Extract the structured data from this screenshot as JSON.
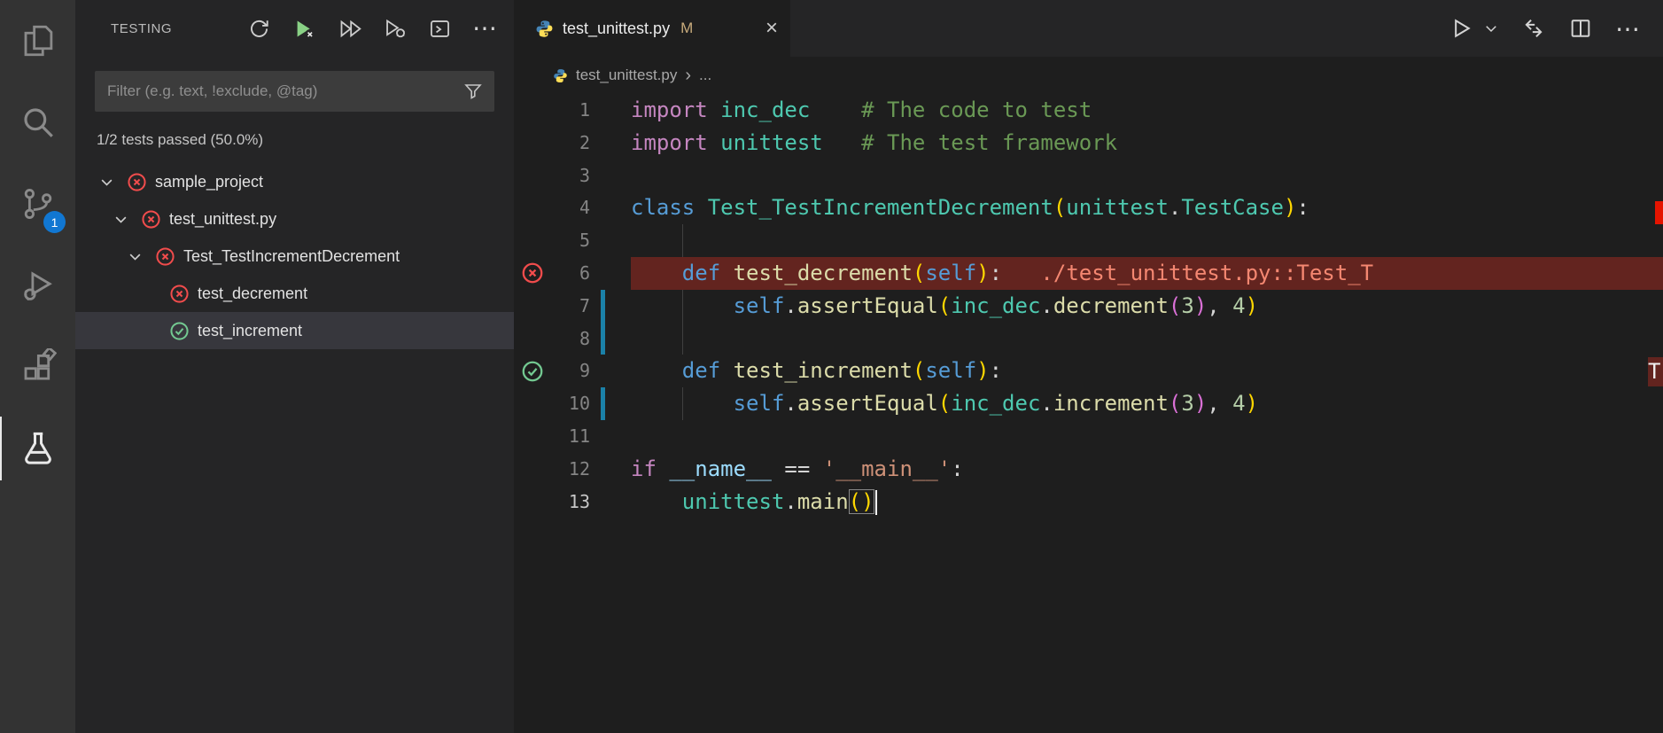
{
  "colors": {
    "accent_blue": "#1177d2",
    "error_red": "#f14c4c",
    "pass_green": "#73c991",
    "modified_gold": "#c8ab7c",
    "error_line_bg": "#63241f",
    "modified_line_blue": "#1b81a8"
  },
  "activity_bar": {
    "source_control_badge": "1"
  },
  "sidebar": {
    "title": "TESTING",
    "filter": {
      "placeholder": "Filter (e.g. text, !exclude, @tag)"
    },
    "status": "1/2 tests passed (50.0%)",
    "tree": [
      {
        "label": "sample_project",
        "state": "fail",
        "expanded": true,
        "indent": 0
      },
      {
        "label": "test_unittest.py",
        "state": "fail",
        "expanded": true,
        "indent": 1
      },
      {
        "label": "Test_TestIncrementDecrement",
        "state": "fail",
        "expanded": true,
        "indent": 2
      },
      {
        "label": "test_decrement",
        "state": "fail",
        "indent": 3,
        "leaf": true
      },
      {
        "label": "test_increment",
        "state": "pass",
        "indent": 3,
        "leaf": true,
        "selected": true
      }
    ]
  },
  "editor": {
    "tab": {
      "label": "test_unittest.py",
      "modified": "M"
    },
    "breadcrumb": {
      "file": "test_unittest.py",
      "more": "..."
    },
    "overlays": {
      "clipped_text": "T"
    },
    "code": {
      "lines": [
        {
          "n": 1,
          "tokens": [
            [
              "kw",
              "import"
            ],
            [
              "pl",
              " "
            ],
            [
              "typ",
              "inc_dec"
            ],
            [
              "pl",
              "    "
            ],
            [
              "cm",
              "# The code to test"
            ]
          ]
        },
        {
          "n": 2,
          "tokens": [
            [
              "kw",
              "import"
            ],
            [
              "pl",
              " "
            ],
            [
              "typ",
              "unittest"
            ],
            [
              "pl",
              "   "
            ],
            [
              "cm",
              "# The test framework"
            ]
          ]
        },
        {
          "n": 3,
          "tokens": []
        },
        {
          "n": 4,
          "tokens": [
            [
              "def",
              "class"
            ],
            [
              "pl",
              " "
            ],
            [
              "typ",
              "Test_TestIncrementDecrement"
            ],
            [
              "b1",
              "("
            ],
            [
              "typ",
              "unittest"
            ],
            [
              "pl",
              "."
            ],
            [
              "typ",
              "TestCase"
            ],
            [
              "b1",
              ")"
            ],
            [
              "pl",
              ":"
            ]
          ]
        },
        {
          "n": 5,
          "guides": [
            4
          ],
          "tokens": []
        },
        {
          "n": 6,
          "error": true,
          "test": "fail",
          "tokens": [
            [
              "pl",
              "    "
            ],
            [
              "def",
              "def"
            ],
            [
              "pl",
              " "
            ],
            [
              "fn",
              "test_decrement"
            ],
            [
              "b1",
              "("
            ],
            [
              "def",
              "self"
            ],
            [
              "b1",
              ")"
            ],
            [
              "pl",
              ":"
            ],
            [
              "pl",
              "   "
            ],
            [
              "err",
              "./test_unittest.py::Test_T"
            ]
          ]
        },
        {
          "n": 7,
          "mod": true,
          "guides": [
            4
          ],
          "tokens": [
            [
              "pl",
              "        "
            ],
            [
              "def",
              "self"
            ],
            [
              "pl",
              "."
            ],
            [
              "fn",
              "assertEqual"
            ],
            [
              "b1",
              "("
            ],
            [
              "typ",
              "inc_dec"
            ],
            [
              "pl",
              "."
            ],
            [
              "fn",
              "decrement"
            ],
            [
              "b2",
              "("
            ],
            [
              "num",
              "3"
            ],
            [
              "b2",
              ")"
            ],
            [
              "pl",
              ", "
            ],
            [
              "num",
              "4"
            ],
            [
              "b1",
              ")"
            ]
          ]
        },
        {
          "n": 8,
          "mod": true,
          "guides": [
            4
          ],
          "tokens": []
        },
        {
          "n": 9,
          "test": "pass",
          "tokens": [
            [
              "pl",
              "    "
            ],
            [
              "def",
              "def"
            ],
            [
              "pl",
              " "
            ],
            [
              "fn",
              "test_increment"
            ],
            [
              "b1",
              "("
            ],
            [
              "def",
              "self"
            ],
            [
              "b1",
              ")"
            ],
            [
              "pl",
              ":"
            ]
          ]
        },
        {
          "n": 10,
          "mod": true,
          "guides": [
            4
          ],
          "tokens": [
            [
              "pl",
              "        "
            ],
            [
              "def",
              "self"
            ],
            [
              "pl",
              "."
            ],
            [
              "fn",
              "assertEqual"
            ],
            [
              "b1",
              "("
            ],
            [
              "typ",
              "inc_dec"
            ],
            [
              "pl",
              "."
            ],
            [
              "fn",
              "increment"
            ],
            [
              "b2",
              "("
            ],
            [
              "num",
              "3"
            ],
            [
              "b2",
              ")"
            ],
            [
              "pl",
              ", "
            ],
            [
              "num",
              "4"
            ],
            [
              "b1",
              ")"
            ]
          ]
        },
        {
          "n": 11,
          "tokens": []
        },
        {
          "n": 12,
          "tokens": [
            [
              "kw",
              "if"
            ],
            [
              "pl",
              " "
            ],
            [
              "var",
              "__name__"
            ],
            [
              "pl",
              " == "
            ],
            [
              "str",
              "'__main__'"
            ],
            [
              "pl",
              ":"
            ]
          ]
        },
        {
          "n": 13,
          "active": true,
          "cursor": true,
          "tokens": [
            [
              "pl",
              "    "
            ],
            [
              "typ",
              "unittest"
            ],
            [
              "pl",
              "."
            ],
            [
              "fn",
              "main"
            ],
            [
              "match",
              "()"
            ]
          ]
        }
      ]
    }
  },
  "icons": {
    "close": "×",
    "ellipsis": "⋯",
    "breadcrumb_sep": "›"
  }
}
